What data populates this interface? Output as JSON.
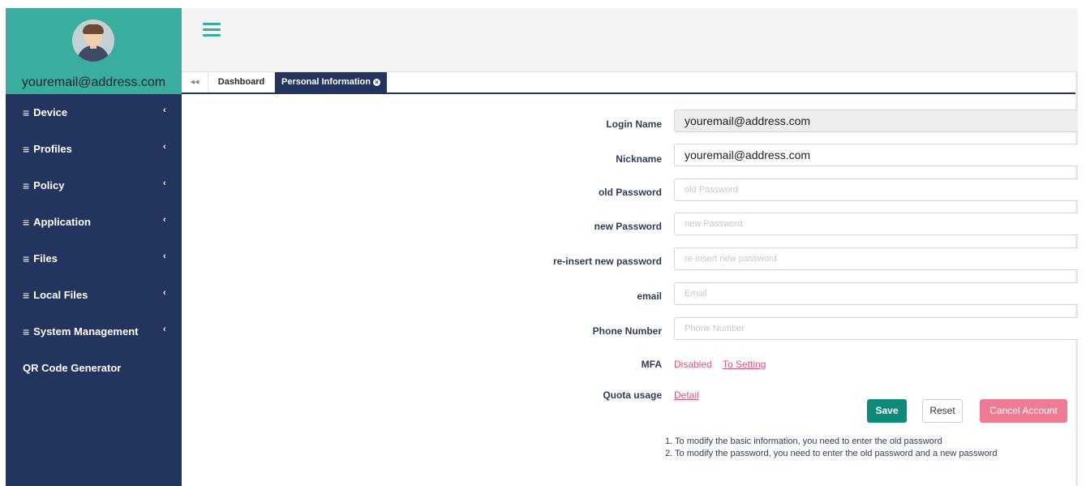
{
  "sidebar": {
    "user_email": "youremail@address.com",
    "items": [
      {
        "label": "Device",
        "has_chevron": true
      },
      {
        "label": "Profiles",
        "has_chevron": true
      },
      {
        "label": "Policy",
        "has_chevron": true
      },
      {
        "label": "Application",
        "has_chevron": true
      },
      {
        "label": "Files",
        "has_chevron": true
      },
      {
        "label": "Local Files",
        "has_chevron": true
      },
      {
        "label": "System Management",
        "has_chevron": true
      },
      {
        "label": "QR Code Generator",
        "has_chevron": false
      }
    ],
    "hamburger_glyph": "≡",
    "chevron_glyph": "‹"
  },
  "tabs": {
    "back_glyph": "◂◂",
    "items": [
      {
        "label": "Dashboard",
        "active": false
      },
      {
        "label": "Personal Information",
        "active": true
      }
    ]
  },
  "form": {
    "login_name": {
      "label": "Login Name",
      "value": "youremail@address.com"
    },
    "nickname": {
      "label": "Nickname",
      "value": "youremail@address.com"
    },
    "old_password": {
      "label": "old Password",
      "placeholder": "old Password"
    },
    "new_password": {
      "label": "new Password",
      "placeholder": "new Password"
    },
    "reinsert_password": {
      "label": "re-insert new password",
      "placeholder": "re-insert new password"
    },
    "email": {
      "label": "email",
      "placeholder": "Email"
    },
    "phone": {
      "label": "Phone Number",
      "placeholder": "Phone Number"
    },
    "mfa": {
      "label": "MFA",
      "status": "Disabled",
      "link": "To Setting"
    },
    "quota": {
      "label": "Quota usage",
      "link": "Detail"
    }
  },
  "buttons": {
    "save": "Save",
    "reset": "Reset",
    "cancel_account": "Cancel Account"
  },
  "notes": [
    "1. To modify the basic information, you need to enter the old password",
    "2. To modify the password, you need to enter the old password and a new password"
  ],
  "colors": {
    "sidebar_bg": "#23345f",
    "profile_bg": "#3aae9e",
    "save_button": "#0e8a7a",
    "cancel_button": "#ef7a93",
    "link": "#e0517a"
  }
}
